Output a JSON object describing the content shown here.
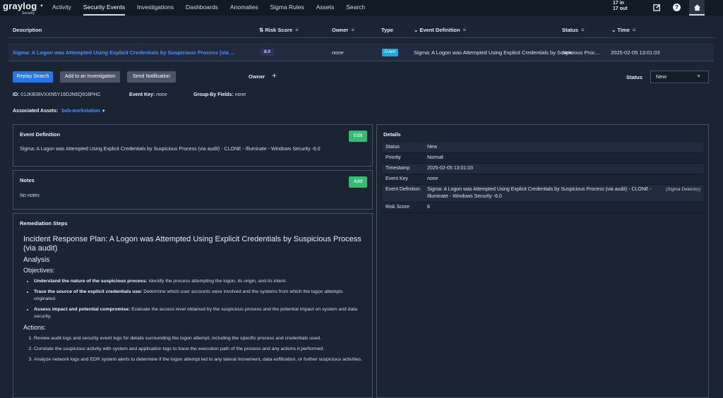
{
  "header": {
    "logo": "graylog",
    "logo_sub": "Security",
    "nav": [
      "Activity",
      "Security Events",
      "Investigations",
      "Dashboards",
      "Anomalies",
      "Sigma Rules",
      "Assets",
      "Search"
    ],
    "active_nav": "Security Events",
    "throughput_in": "17 in",
    "throughput_out": "17 out",
    "icons": [
      "edit-icon",
      "help-icon",
      "home-icon"
    ]
  },
  "table": {
    "columns": [
      "Description",
      "Risk Score",
      "Owner",
      "Type",
      "Event Definition",
      "Status",
      "Time"
    ],
    "row": {
      "description": "Sigma: A Logon was Attempted Using Explicit Credentials by Suspicious Process (via ...",
      "risk_score": "8.0",
      "owner": "none",
      "type": "Event",
      "event_definition": "Sigma: A Logon was Attempted Using Explicit Credentials by Suspicious Proc...",
      "status": "New",
      "time": "2025-02-05 13:01:03"
    }
  },
  "actions": {
    "replay": "Replay Search",
    "investigation": "Add to an Investigation",
    "notification": "Send Notification",
    "owner_label": "Owner",
    "status_label": "Status",
    "status_value": "New"
  },
  "meta": {
    "id_label": "ID:",
    "id_value": "01JKB38VXXN5Y16DJN6Q918PHC",
    "event_key_label": "Event Key:",
    "event_key_value": "none",
    "group_by_label": "Group-By Fields:",
    "group_by_value": "none",
    "assets_label": "Associated Assets:",
    "asset": "bob-workstation"
  },
  "event_definition_panel": {
    "title": "Event Definition",
    "edit": "Edit",
    "text": "Sigma: A Logon was Attempted Using Explicit Credentials by Suspicious Process (via audit) - CLONE - Illuminate - Windows Security -6.0"
  },
  "notes_panel": {
    "title": "Notes",
    "add": "Add",
    "text": "No notes"
  },
  "details_panel": {
    "title": "Details",
    "rows": [
      {
        "k": "Status",
        "v": "New"
      },
      {
        "k": "Priority",
        "v": "Normal"
      },
      {
        "k": "Timestamp",
        "v": "2025-02-05 13:01:03"
      },
      {
        "k": "Event Key",
        "v": "none"
      },
      {
        "k": "Event Definition",
        "v": "Sigma: A Logon was Attempted Using Explicit Credentials by Suspicious Process (via audit) - CLONE - Illuminate - Windows Security -6.0",
        "extra": "(Sigma Detector)"
      },
      {
        "k": "Risk Score",
        "v": "8"
      }
    ]
  },
  "remediation": {
    "title": "Remediation Steps",
    "plan_title": "Incident Response Plan: A Logon was Attempted Using Explicit Credentials by Suspicious Process (via audit)",
    "analysis": "Analysis",
    "objectives": "Objectives:",
    "objective_items": [
      {
        "b": "Understand the nature of the suspicious process:",
        "t": " Identify the process attempting the logon, its origin, and its intent."
      },
      {
        "b": "Trace the source of the explicit credentials use:",
        "t": " Determine which user accounts were involved and the systems from which the logon attempts originated."
      },
      {
        "b": "Assess impact and potential compromise:",
        "t": " Evaluate the access level obtained by the suspicious process and the potential impact on system and data security."
      }
    ],
    "actions": "Actions:",
    "action_items": [
      "Review audit logs and security event logs for details surrounding the logon attempt, including the specific process and credentials used.",
      "Correlate the suspicious activity with system and application logs to trace the execution path of the process and any actions it performed.",
      "Analyze network logs and EDR system alerts to determine if the logon attempt led to any lateral movement, data exfiltration, or further suspicious activities."
    ]
  }
}
